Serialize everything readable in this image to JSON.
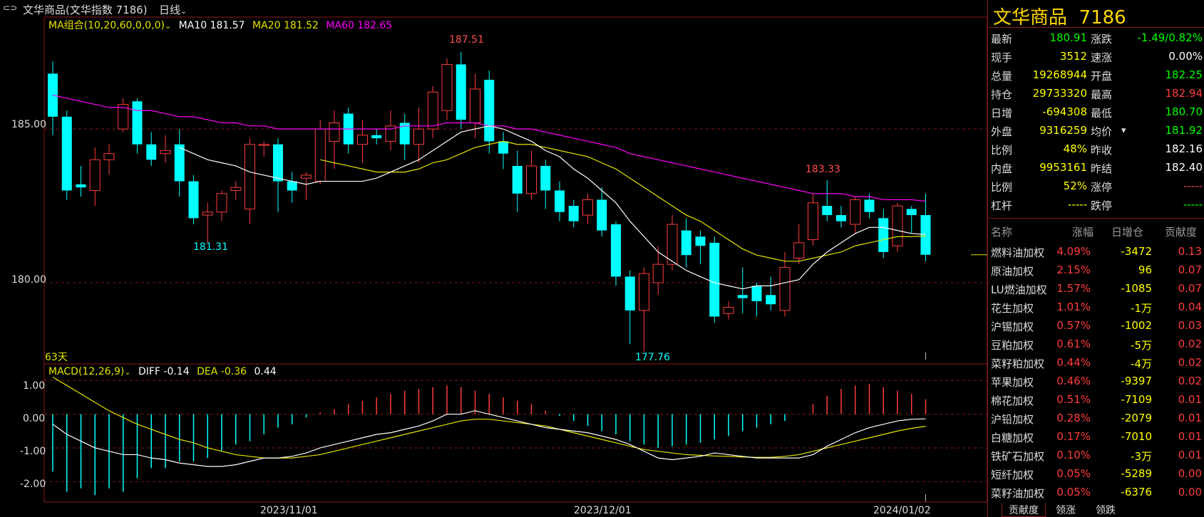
{
  "topbar": {
    "title": "文华商品(文华指数 7186)",
    "period": "日线"
  },
  "main_chart": {
    "ma_label": "MA组合(10,20,60,0,0,0)",
    "ma10": "MA10 181.57",
    "ma20": "MA20 181.52",
    "ma60": "MA60 182.65",
    "days": "63天",
    "y_ticks": [
      "185.00",
      "180.00"
    ],
    "annotations": [
      "187.51",
      "183.33",
      "181.31",
      "177.76"
    ]
  },
  "macd_chart": {
    "label": "MACD(12,26,9)",
    "diff": "DIFF -0.14",
    "dea": "DEA -0.36",
    "macd": "0.44",
    "y_ticks": [
      "1.00",
      "0.00",
      "-1.00",
      "-2.00"
    ]
  },
  "x_axis": [
    "2023/11/01",
    "2023/12/01",
    "2024/01/02"
  ],
  "colors": {
    "up": "#ff3c3c",
    "down": "#00ffff",
    "ma10": "#ffffff",
    "ma20": "#e5e500",
    "ma60": "#ff00ff",
    "panel_title": "#ffd700"
  },
  "chart_data": {
    "type": "candlestick",
    "days": 63,
    "candles": [
      [
        186.8,
        185.4,
        187.2,
        184.8
      ],
      [
        185.4,
        183.0,
        185.6,
        182.7
      ],
      [
        183.2,
        183.1,
        183.8,
        182.8
      ],
      [
        183.0,
        184.0,
        184.4,
        182.5
      ],
      [
        184.0,
        184.2,
        184.5,
        183.5
      ],
      [
        185.0,
        185.8,
        186.0,
        184.9
      ],
      [
        185.9,
        184.5,
        186.0,
        184.2
      ],
      [
        184.5,
        184.0,
        184.9,
        183.8
      ],
      [
        184.2,
        184.3,
        184.8,
        183.9
      ],
      [
        184.5,
        183.3,
        185.0,
        182.8
      ],
      [
        183.3,
        182.1,
        183.5,
        181.9
      ],
      [
        182.2,
        182.3,
        182.6,
        181.3
      ],
      [
        182.3,
        182.9,
        183.0,
        182.0
      ],
      [
        183.0,
        183.1,
        183.3,
        182.7
      ],
      [
        182.4,
        184.5,
        184.7,
        181.9
      ],
      [
        184.5,
        184.5,
        184.6,
        184.1
      ],
      [
        184.5,
        183.3,
        184.7,
        182.3
      ],
      [
        183.3,
        183.0,
        183.6,
        182.6
      ],
      [
        183.4,
        183.5,
        183.6,
        182.7
      ],
      [
        183.3,
        185.0,
        185.3,
        183.2
      ],
      [
        184.6,
        185.2,
        185.6,
        183.7
      ],
      [
        185.5,
        184.5,
        185.7,
        184.2
      ],
      [
        184.5,
        184.8,
        185.3,
        183.9
      ],
      [
        184.8,
        184.7,
        185.0,
        184.5
      ],
      [
        184.6,
        185.1,
        185.6,
        184.3
      ],
      [
        185.2,
        184.5,
        185.5,
        184.0
      ],
      [
        184.5,
        185.0,
        185.7,
        183.9
      ],
      [
        185.0,
        186.2,
        186.4,
        184.7
      ],
      [
        185.6,
        187.1,
        187.3,
        185.3
      ],
      [
        187.1,
        185.3,
        187.51,
        185.0
      ],
      [
        185.2,
        186.3,
        186.8,
        184.7
      ],
      [
        186.6,
        184.6,
        186.9,
        184.2
      ],
      [
        184.6,
        184.2,
        184.9,
        183.7
      ],
      [
        183.8,
        182.9,
        184.3,
        182.3
      ],
      [
        182.9,
        183.8,
        184.3,
        182.7
      ],
      [
        183.8,
        183.0,
        184.0,
        182.4
      ],
      [
        183.0,
        182.3,
        183.3,
        182.0
      ],
      [
        182.5,
        182.0,
        182.7,
        181.8
      ],
      [
        182.2,
        182.7,
        182.9,
        181.9
      ],
      [
        182.7,
        181.7,
        183.1,
        181.5
      ],
      [
        181.9,
        180.2,
        182.0,
        179.9
      ],
      [
        180.2,
        179.1,
        180.4,
        178.0
      ],
      [
        179.1,
        180.3,
        180.5,
        177.76
      ],
      [
        180.0,
        180.6,
        181.2,
        179.6
      ],
      [
        180.6,
        181.9,
        182.2,
        180.4
      ],
      [
        181.7,
        180.9,
        182.1,
        180.5
      ],
      [
        181.5,
        181.2,
        181.7,
        180.6
      ],
      [
        181.3,
        178.9,
        181.5,
        178.7
      ],
      [
        179.0,
        179.2,
        179.4,
        178.8
      ],
      [
        179.6,
        179.5,
        180.5,
        179.0
      ],
      [
        179.9,
        179.4,
        180.0,
        178.9
      ],
      [
        179.6,
        179.3,
        180.2,
        179.1
      ],
      [
        179.1,
        180.5,
        181.0,
        178.9
      ],
      [
        180.8,
        181.3,
        181.9,
        180.6
      ],
      [
        181.4,
        182.6,
        182.9,
        181.2
      ],
      [
        182.5,
        182.2,
        183.33,
        182.0
      ],
      [
        182.2,
        182.0,
        182.5,
        181.8
      ],
      [
        181.9,
        182.7,
        182.8,
        181.6
      ],
      [
        182.7,
        182.3,
        182.9,
        182.1
      ],
      [
        182.1,
        181.0,
        182.4,
        180.8
      ],
      [
        181.2,
        182.5,
        182.6,
        181.0
      ],
      [
        182.4,
        182.2,
        182.5,
        181.6
      ],
      [
        182.2,
        180.91,
        182.9,
        180.7
      ]
    ],
    "ma10": [
      null,
      null,
      null,
      null,
      null,
      null,
      null,
      null,
      null,
      184.4,
      184.2,
      184.0,
      183.9,
      183.8,
      183.6,
      183.5,
      183.4,
      183.3,
      183.2,
      183.3,
      183.3,
      183.3,
      183.3,
      183.4,
      183.6,
      183.8,
      184.0,
      184.3,
      184.6,
      184.9,
      185.0,
      185.1,
      185.0,
      184.8,
      184.6,
      184.3,
      184.1,
      183.7,
      183.4,
      183.0,
      182.6,
      182.0,
      181.5,
      181.0,
      180.7,
      180.4,
      180.2,
      180.0,
      179.9,
      179.8,
      179.9,
      179.9,
      180.0,
      180.1,
      180.6,
      181.0,
      181.3,
      181.6,
      181.8,
      181.8,
      181.7,
      181.6,
      181.57
    ],
    "ma20": [
      null,
      null,
      null,
      null,
      null,
      null,
      null,
      null,
      null,
      null,
      null,
      null,
      null,
      null,
      null,
      null,
      null,
      null,
      null,
      184.0,
      183.9,
      183.8,
      183.7,
      183.6,
      183.6,
      183.6,
      183.7,
      183.9,
      184.0,
      184.2,
      184.4,
      184.5,
      184.6,
      184.5,
      184.5,
      184.4,
      184.3,
      184.2,
      184.1,
      183.9,
      183.7,
      183.4,
      183.1,
      182.8,
      182.5,
      182.2,
      182.0,
      181.7,
      181.4,
      181.1,
      180.9,
      180.8,
      180.7,
      180.7,
      180.8,
      180.9,
      181.0,
      181.2,
      181.3,
      181.4,
      181.5,
      181.5,
      181.52
    ],
    "ma60": [
      186.1,
      186.0,
      185.9,
      185.8,
      185.7,
      185.7,
      185.6,
      185.6,
      185.5,
      185.4,
      185.4,
      185.3,
      185.2,
      185.2,
      185.1,
      185.1,
      185.0,
      185.0,
      185.0,
      185.0,
      185.0,
      185.0,
      185.0,
      185.0,
      185.0,
      185.1,
      185.1,
      185.1,
      185.2,
      185.2,
      185.2,
      185.1,
      185.1,
      185.0,
      185.0,
      184.9,
      184.8,
      184.7,
      184.6,
      184.5,
      184.4,
      184.2,
      184.1,
      184.0,
      183.9,
      183.8,
      183.7,
      183.6,
      183.5,
      183.4,
      183.3,
      183.2,
      183.1,
      183.0,
      182.9,
      182.9,
      182.9,
      182.8,
      182.8,
      182.7,
      182.7,
      182.7,
      182.65
    ],
    "macd_hist": [
      -1.7,
      -2.3,
      -2.2,
      -2.4,
      -2.2,
      -2.3,
      -1.9,
      -1.6,
      -1.6,
      -1.4,
      -1.4,
      -1.3,
      -1.1,
      -0.9,
      -0.8,
      -0.6,
      -0.4,
      -0.3,
      -0.1,
      0.05,
      0.15,
      0.3,
      0.4,
      0.5,
      0.6,
      0.7,
      0.75,
      0.8,
      0.85,
      0.8,
      0.7,
      0.6,
      0.5,
      0.4,
      0.3,
      0.1,
      -0.05,
      -0.2,
      -0.35,
      -0.5,
      -0.6,
      -0.8,
      -0.9,
      -1.0,
      -0.95,
      -0.9,
      -0.85,
      -0.75,
      -0.65,
      -0.5,
      -0.4,
      -0.3,
      -0.2,
      0.0,
      0.3,
      0.55,
      0.75,
      0.85,
      0.9,
      0.8,
      0.7,
      0.6,
      0.44
    ],
    "diff": [
      -0.3,
      -0.6,
      -0.8,
      -1.0,
      -1.1,
      -1.2,
      -1.2,
      -1.3,
      -1.35,
      -1.45,
      -1.5,
      -1.55,
      -1.55,
      -1.5,
      -1.4,
      -1.3,
      -1.3,
      -1.25,
      -1.15,
      -1.0,
      -0.9,
      -0.8,
      -0.7,
      -0.6,
      -0.55,
      -0.45,
      -0.35,
      -0.2,
      0.0,
      0.0,
      0.1,
      0.0,
      -0.1,
      -0.2,
      -0.3,
      -0.4,
      -0.45,
      -0.5,
      -0.55,
      -0.65,
      -0.75,
      -0.9,
      -1.1,
      -1.3,
      -1.35,
      -1.3,
      -1.25,
      -1.15,
      -1.2,
      -1.25,
      -1.3,
      -1.3,
      -1.3,
      -1.3,
      -1.2,
      -0.95,
      -0.75,
      -0.55,
      -0.4,
      -0.3,
      -0.2,
      -0.15,
      -0.14
    ],
    "dea": [
      1.1,
      0.85,
      0.6,
      0.35,
      0.1,
      -0.1,
      -0.3,
      -0.45,
      -0.6,
      -0.75,
      -0.85,
      -1.0,
      -1.1,
      -1.2,
      -1.25,
      -1.3,
      -1.3,
      -1.3,
      -1.25,
      -1.2,
      -1.1,
      -1.0,
      -0.9,
      -0.8,
      -0.7,
      -0.6,
      -0.5,
      -0.4,
      -0.3,
      -0.2,
      -0.15,
      -0.15,
      -0.2,
      -0.25,
      -0.3,
      -0.35,
      -0.45,
      -0.55,
      -0.65,
      -0.75,
      -0.85,
      -0.95,
      -1.05,
      -1.1,
      -1.15,
      -1.2,
      -1.22,
      -1.24,
      -1.25,
      -1.27,
      -1.28,
      -1.28,
      -1.25,
      -1.2,
      -1.1,
      -1.0,
      -0.9,
      -0.8,
      -0.7,
      -0.6,
      -0.5,
      -0.42,
      -0.36
    ],
    "y_range": [
      177.5,
      188.5
    ],
    "macd_range": [
      -2.5,
      1.3
    ]
  },
  "panel": {
    "title": "文华商品  7186",
    "quotes": [
      {
        "l1": "最新",
        "v1": "180.91",
        "c1": "#00ff00",
        "l2": "涨跌",
        "v2": "-1.49/0.82%",
        "c2": "#00ff00"
      },
      {
        "l1": "现手",
        "v1": "3512",
        "c1": "#ffff00",
        "l2": "速涨",
        "v2": "0.00%",
        "c2": "#ffffff"
      },
      {
        "l1": "总量",
        "v1": "19268944",
        "c1": "#ffff00",
        "l2": "开盘",
        "v2": "182.25",
        "c2": "#00ff00"
      },
      {
        "l1": "持仓",
        "v1": "29733320",
        "c1": "#ffff00",
        "l2": "最高",
        "v2": "182.94",
        "c2": "#ff3c3c"
      },
      {
        "l1": "日增",
        "v1": "-694308",
        "c1": "#ffff00",
        "l2": "最低",
        "v2": "180.70",
        "c2": "#00ff00"
      },
      {
        "l1": "外盘",
        "v1": "9316259",
        "c1": "#ffff00",
        "l2": "均价",
        "v2": "181.92",
        "c2": "#00ff00"
      },
      {
        "l1": "比例",
        "v1": "48%",
        "c1": "#ffff00",
        "l2": "昨收",
        "v2": "182.16",
        "c2": "#ffffff"
      },
      {
        "l1": "内盘",
        "v1": "9953161",
        "c1": "#ffff00",
        "l2": "昨结",
        "v2": "182.40",
        "c2": "#ffffff"
      },
      {
        "l1": "比例",
        "v1": "52%",
        "c1": "#ffff00",
        "l2": "涨停",
        "v2": "-----",
        "c2": "#ff3c3c"
      },
      {
        "l1": "杠杆",
        "v1": "-----",
        "c1": "#ffff00",
        "l2": "跌停",
        "v2": "-----",
        "c2": "#00ff00"
      }
    ],
    "table_header": [
      "名称",
      "涨幅",
      "日增仓",
      "贡献度"
    ],
    "rows": [
      {
        "name": "燃料油加权",
        "pct": "4.09%",
        "inc": "-3472",
        "contrib": "0.13"
      },
      {
        "name": "原油加权",
        "pct": "2.15%",
        "inc": "96",
        "contrib": "0.07"
      },
      {
        "name": "LU燃油加权",
        "pct": "1.57%",
        "inc": "-1085",
        "contrib": "0.07"
      },
      {
        "name": "花生加权",
        "pct": "1.01%",
        "inc": "-1万",
        "contrib": "0.04"
      },
      {
        "name": "沪锡加权",
        "pct": "0.57%",
        "inc": "-1002",
        "contrib": "0.03"
      },
      {
        "name": "豆粕加权",
        "pct": "0.61%",
        "inc": "-5万",
        "contrib": "0.02"
      },
      {
        "name": "菜籽粕加权",
        "pct": "0.44%",
        "inc": "-4万",
        "contrib": "0.02"
      },
      {
        "name": "苹果加权",
        "pct": "0.46%",
        "inc": "-9397",
        "contrib": "0.02"
      },
      {
        "name": "棉花加权",
        "pct": "0.51%",
        "inc": "-7109",
        "contrib": "0.01"
      },
      {
        "name": "沪铅加权",
        "pct": "0.28%",
        "inc": "-2079",
        "contrib": "0.01"
      },
      {
        "name": "白糖加权",
        "pct": "0.17%",
        "inc": "-7010",
        "contrib": "0.01"
      },
      {
        "name": "铁矿石加权",
        "pct": "0.10%",
        "inc": "-3万",
        "contrib": "0.01"
      },
      {
        "name": "短纤加权",
        "pct": "0.05%",
        "inc": "-5289",
        "contrib": "0.00"
      },
      {
        "name": "菜籽油加权",
        "pct": "0.05%",
        "inc": "-6376",
        "contrib": "0.00"
      }
    ],
    "tabs": [
      "贡献度",
      "领涨",
      "领跌"
    ]
  }
}
